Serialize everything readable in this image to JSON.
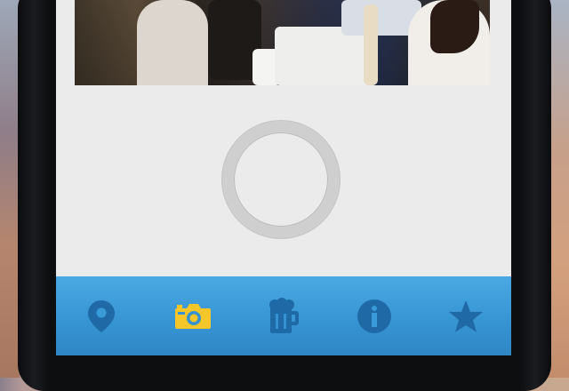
{
  "tabbar": {
    "tabs": [
      {
        "icon": "map-pin-icon",
        "active": false
      },
      {
        "icon": "camera-icon",
        "active": true
      },
      {
        "icon": "beer-mug-icon",
        "active": false
      },
      {
        "icon": "info-icon",
        "active": false
      },
      {
        "icon": "star-icon",
        "active": false
      }
    ]
  },
  "colors": {
    "tabbar": "#3795d4",
    "icon_inactive": "#1f6aa6",
    "icon_active": "#f5c62a",
    "screen_background": "#ebebeb",
    "shutter_ring": "#cfcfcf"
  }
}
